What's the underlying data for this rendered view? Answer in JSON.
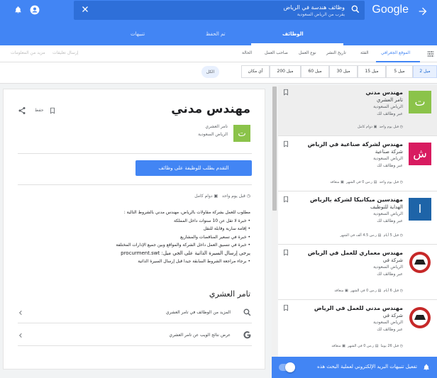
{
  "app": {
    "logo": "Google",
    "back_icon": "arrow-forward-icon"
  },
  "search": {
    "query": "وظائف هندسة في الرياض",
    "subtitle": "يقرب من الرياض السعودية"
  },
  "tabs": [
    {
      "label": "الوظائف",
      "active": true
    },
    {
      "label": "تم الحفظ",
      "active": false
    },
    {
      "label": "تنبيهات",
      "active": false
    }
  ],
  "filters": {
    "items": [
      "الموقع الجغرافي",
      "الفئة",
      "تاريخ النشر",
      "نوع العمل",
      "صاحب العمل",
      "الحالة"
    ],
    "disabled": [
      "إرسال تعليقات",
      "مزيد من المعلومات"
    ]
  },
  "distance": {
    "chips": [
      "2 ميل",
      "5 ميل",
      "15 ميل",
      "30 ميل",
      "60 ميل",
      "200 ميل",
      "أي مكان"
    ],
    "active": "2 ميل",
    "all_label": "الكل"
  },
  "jobs": [
    {
      "title": "مهندس مدني",
      "company": "تامر العشري",
      "location": "الرياض السعودية",
      "via": "عبر وظائف لك",
      "age": "قبل يوم واحد",
      "type": "دوام كامل",
      "salary": "",
      "logo_text": "ت",
      "logo_color": "#8bc34a"
    },
    {
      "title": "مهندس لشركة صناعية في الرياض",
      "company": "شركة صناعية",
      "location": "الرياض السعودية",
      "via": "عبر وظائف لك",
      "age": "قبل يوم واحد",
      "type": "متعاقد",
      "salary": "ر.س 0 في الشهر",
      "logo_text": "ش",
      "logo_color": "#d81b60"
    },
    {
      "title": "مهندسين ميكانيكا لشركة بالرياض",
      "company": "الهداية للتوظيف",
      "location": "الرياض السعودية",
      "via": "عبر وظائف لك",
      "age": "قبل 5 أيام",
      "type": "",
      "salary": "ر.س 4.5 ألف في الشهر",
      "logo_text": "ا",
      "logo_color": "#1e64a8"
    },
    {
      "title": "مهندس معماري للعمل في الرياض",
      "company": "شركة في",
      "location": "الرياض السعودية",
      "via": "عبر وظائف لك",
      "age": "قبل 6 أيام",
      "type": "متعاقد",
      "salary": "ر.س 0 في الشهر",
      "logo_text": "",
      "logo_color": "#c62828"
    },
    {
      "title": "مهندس مدني للعمل في الرياض",
      "company": "شركة في",
      "location": "الرياض السعودية",
      "via": "عبر وظائف لك",
      "age": "قبل 26 يوما",
      "type": "متعاقد",
      "salary": "ر.س 0 في الشهر",
      "logo_text": "",
      "logo_color": "#c62828"
    }
  ],
  "notify": {
    "text": "تفعيل تنبيهات البريد الإلكتروني لعملية البحث هذه",
    "enabled": true
  },
  "detail": {
    "title": "مهندس مدني",
    "save_label": "حفظ",
    "company": "تامر العشري",
    "location": "الرياض السعودية",
    "logo_text": "ت",
    "apply_label": "التقدم بطلب للوظيفة على وظائف",
    "age": "قبل يوم واحد",
    "type": "دوام كامل",
    "body": [
      "مطلوب للعمل بشركة مقاولات بالرياض، مهندس مدني بالشروط التالية :",
      "• خبرة لا تقل عن 10 سنوات داخل المملكة",
      "• إقامة سارية وقابلة للنقل",
      "• خبرة في تسعير المناقصات والمشاريع",
      "• خبرة في تنسيق العمل داخل الشركة والمواقع وبين جميع الإدارات المختلفة",
      "يرجى إرسال السيرة الذاتية على الجي ميل: procurment.swt",
      "• برجاء مراجعة الشروط السابقة جيدا قبل إرسال السيرة الذاتية"
    ],
    "company_section": "تامر العشري",
    "links": [
      {
        "label": "المزيد من الوظائف في تامر العشري",
        "icon": "search-icon"
      },
      {
        "label": "عرض نتائج الويب عن تامر العشري",
        "icon": "google-g-icon"
      }
    ]
  }
}
